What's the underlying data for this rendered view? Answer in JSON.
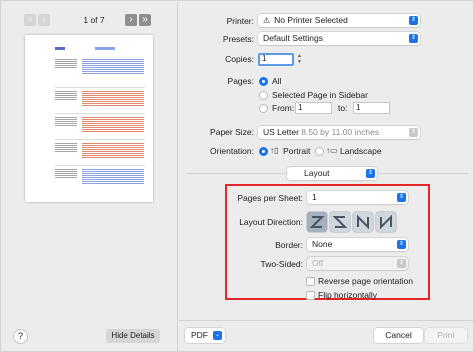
{
  "preview": {
    "prev_first_icon": "chevron-double-left",
    "prev_icon": "chevron-left",
    "next_icon": "chevron-right",
    "next_last_icon": "chevron-double-right",
    "page_count": "1 of 7",
    "help_label": "?",
    "hide_details_label": "Hide Details"
  },
  "settings": {
    "printer": {
      "label": "Printer:",
      "value": "No Printer Selected"
    },
    "presets": {
      "label": "Presets:",
      "value": "Default Settings"
    },
    "copies": {
      "label": "Copies:",
      "value": "1"
    },
    "pages": {
      "label": "Pages:",
      "all": "All",
      "selected_page": "Selected Page in Sidebar",
      "from_label": "From:",
      "from_value": "1",
      "to_label": "to:",
      "to_value": "1"
    },
    "paper_size": {
      "label": "Paper Size:",
      "value": "US Letter",
      "detail": "8.50 by 11.00 inches"
    },
    "orientation": {
      "label": "Orientation:",
      "portrait": "Portrait",
      "landscape": "Landscape"
    },
    "section": "Layout"
  },
  "layout": {
    "pages_per_sheet": {
      "label": "Pages per Sheet:",
      "value": "1"
    },
    "layout_direction": {
      "label": "Layout Direction:",
      "options": [
        "Z",
        "reverse Z",
        "N",
        "reverse N"
      ]
    },
    "border": {
      "label": "Border:",
      "value": "None"
    },
    "two_sided": {
      "label": "Two-Sided:",
      "value": "Off"
    },
    "reverse_orientation": "Reverse page orientation",
    "flip_horizontally": "Flip horizontally"
  },
  "footer": {
    "pdf": "PDF",
    "cancel": "Cancel",
    "print": "Print"
  },
  "colors": {
    "accent": "#1a74e8",
    "highlight": "#e2262a"
  }
}
